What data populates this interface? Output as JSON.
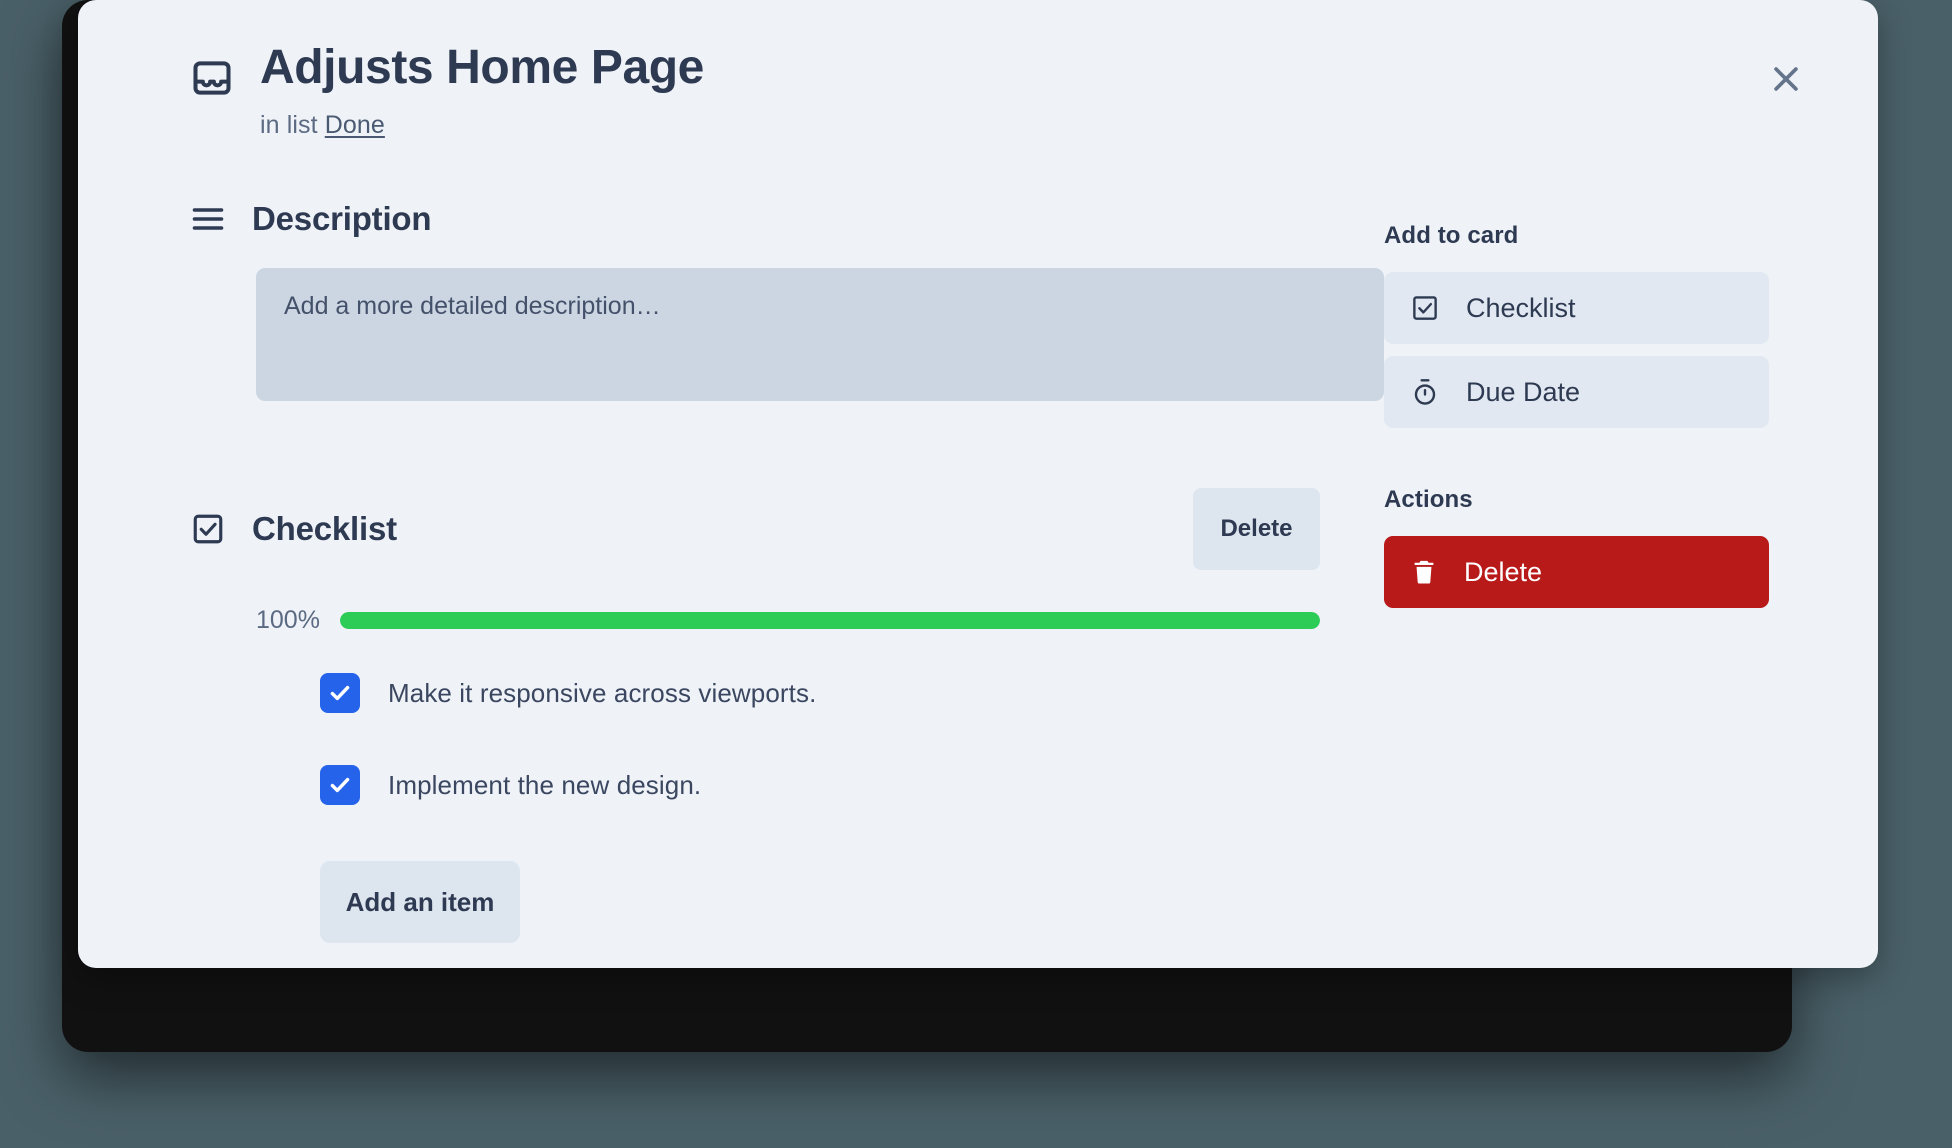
{
  "modal": {
    "title": "Adjusts Home Page",
    "title_icon": "inbox-card-icon",
    "subtitle_prefix": "in list",
    "list_name": "Done",
    "close_icon": "close-icon"
  },
  "description": {
    "heading": "Description",
    "heading_icon": "list-lines-icon",
    "value": "",
    "placeholder": "Add a more detailed description…"
  },
  "checklist": {
    "heading": "Checklist",
    "heading_icon": "checkbox-square-icon",
    "delete_label": "Delete",
    "progress_label": "100%",
    "progress_value": 100,
    "progress_color": "#2dcc57",
    "items": [
      {
        "label": "Make it responsive across viewports.",
        "checked": true
      },
      {
        "label": "Implement the new design.",
        "checked": true
      }
    ],
    "add_item_label": "Add an item"
  },
  "sidebar": {
    "add_to_card_heading": "Add to card",
    "add_to_card_items": [
      {
        "label": "Checklist",
        "icon": "checkbox-square-icon"
      },
      {
        "label": "Due Date",
        "icon": "stopwatch-icon"
      }
    ],
    "actions_heading": "Actions",
    "actions": [
      {
        "label": "Delete",
        "icon": "trash-icon",
        "color": "#b81919"
      }
    ]
  },
  "colors": {
    "page_background": "#4a6068",
    "backdrop": "#111111",
    "modal_background": "#eff3f8",
    "text_primary": "#2e3a52",
    "text_secondary": "#5b6a82",
    "field_background": "#ccd6e3",
    "subtle_button": "#dde5ef",
    "checkbox_blue": "#2563eb",
    "progress_green": "#2dcc57",
    "danger_red": "#b81919"
  }
}
